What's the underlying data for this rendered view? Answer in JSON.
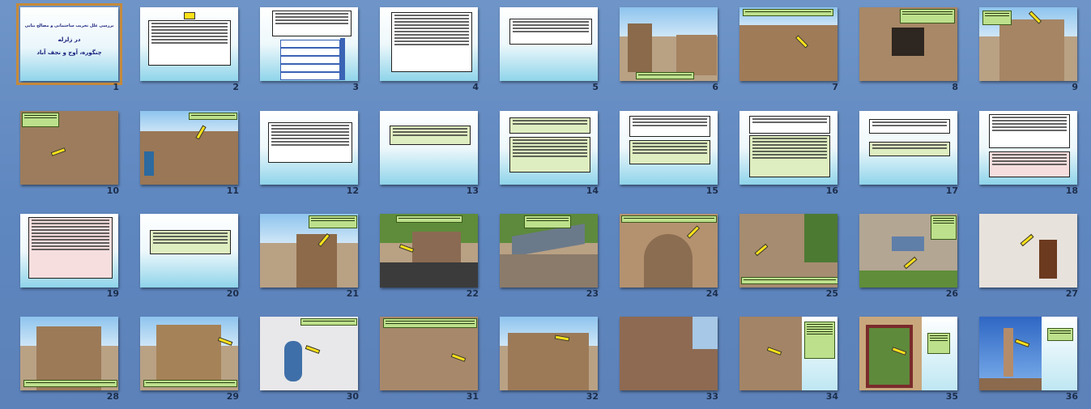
{
  "view": "slide-sorter",
  "selected_slide": 1,
  "title_slide": {
    "heading": "بررسی علل تخریب ساختمانی و مصالح بنایی",
    "place_line": "در زلزله",
    "villages": "چنگوره، آوج و نجف آباد"
  },
  "slide_numbers": [
    "1",
    "2",
    "3",
    "4",
    "5",
    "6",
    "7",
    "8",
    "9",
    "10",
    "11",
    "12",
    "13",
    "14",
    "15",
    "16",
    "17",
    "18",
    "19",
    "20",
    "21",
    "22",
    "23",
    "24",
    "25",
    "26",
    "27",
    "28",
    "29",
    "30",
    "31",
    "32",
    "33",
    "34",
    "35",
    "36"
  ],
  "slide_kinds": [
    "title",
    "text",
    "list",
    "text",
    "text",
    "photo",
    "photo",
    "photo",
    "photo",
    "photo",
    "photo",
    "text",
    "text",
    "text",
    "text",
    "text",
    "text",
    "text",
    "text",
    "text",
    "photo",
    "photo",
    "photo",
    "photo",
    "photo",
    "photo",
    "photo",
    "photo",
    "photo",
    "photo",
    "photo",
    "photo",
    "photo",
    "split",
    "split",
    "split"
  ]
}
